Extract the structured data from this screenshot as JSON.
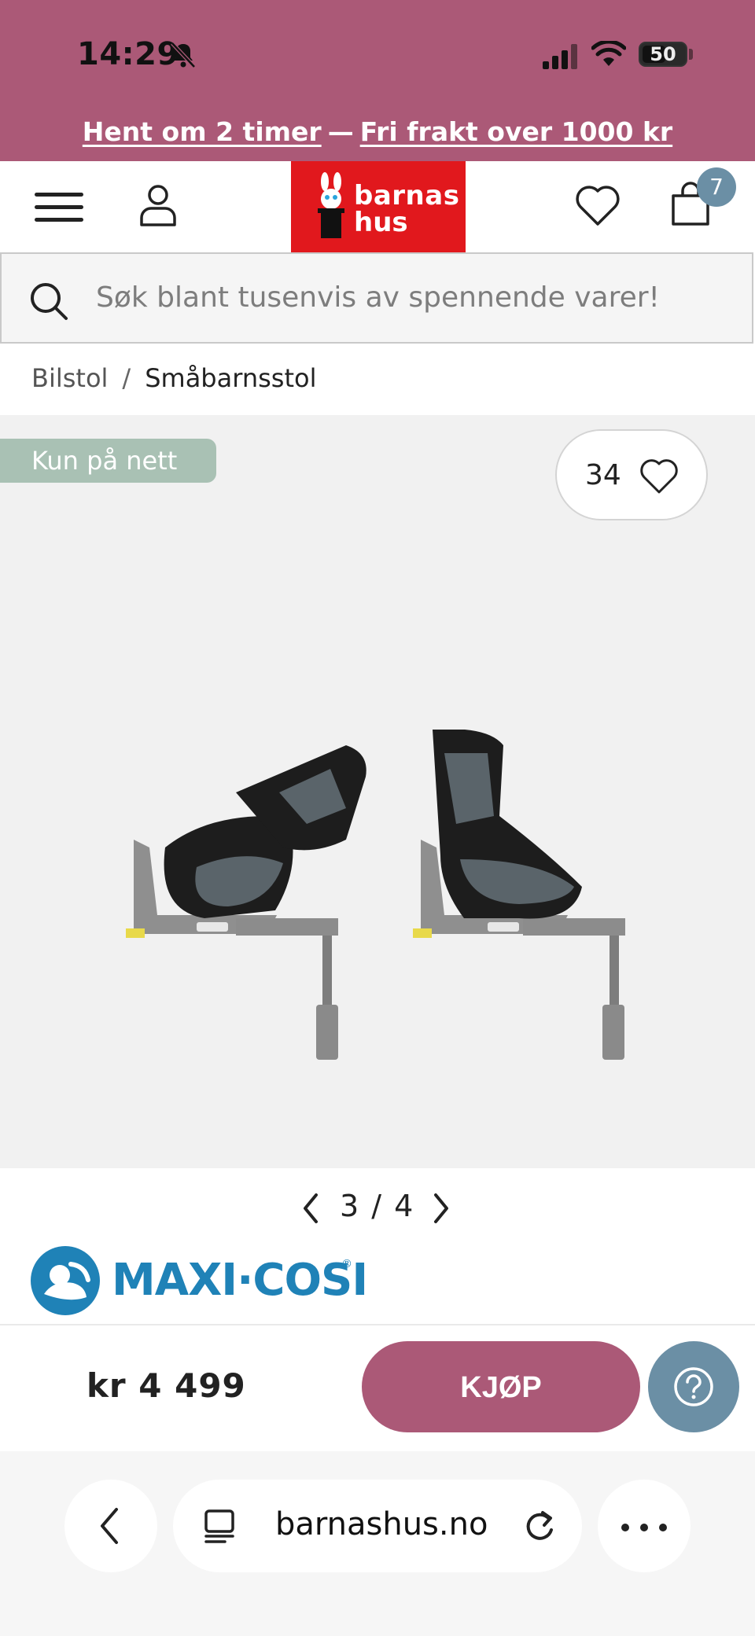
{
  "status_bar": {
    "time": "14:29",
    "battery": "50",
    "icons": [
      "bell-slash-icon",
      "signal-icon",
      "wifi-icon",
      "battery-icon"
    ]
  },
  "promo": {
    "pickup_link": "Hent om 2 timer",
    "separator": "—",
    "shipping_link": "Fri frakt over 1000 kr"
  },
  "header": {
    "icons": [
      "menu-icon",
      "user-icon",
      "heart-icon",
      "bag-icon"
    ],
    "logo_line1": "barnas",
    "logo_line2": "hus",
    "cart_count": "7"
  },
  "search": {
    "placeholder": "Søk blant tusenvis av spennende varer!"
  },
  "breadcrumb": {
    "items": [
      "Bilstol",
      "Småbarnsstol"
    ],
    "separator": "/"
  },
  "product": {
    "badge": "Kun på nett",
    "favorite_count": "34",
    "gallery_position": "3 / 4",
    "brand": "MAXI·COSI",
    "brand_reg": "®",
    "price": "kr 4 499",
    "buy_label": "KJØP"
  },
  "browser": {
    "url": "barnashus.no",
    "icons": [
      "back-icon",
      "tab-icon",
      "reload-icon",
      "more-icon"
    ]
  },
  "colors": {
    "brand_pink": "#ab5977",
    "logo_red": "#e1181d",
    "badge_green": "#a9c1b4",
    "help_blue": "#6b8fa5",
    "maxicosi_blue": "#1f82b7"
  }
}
